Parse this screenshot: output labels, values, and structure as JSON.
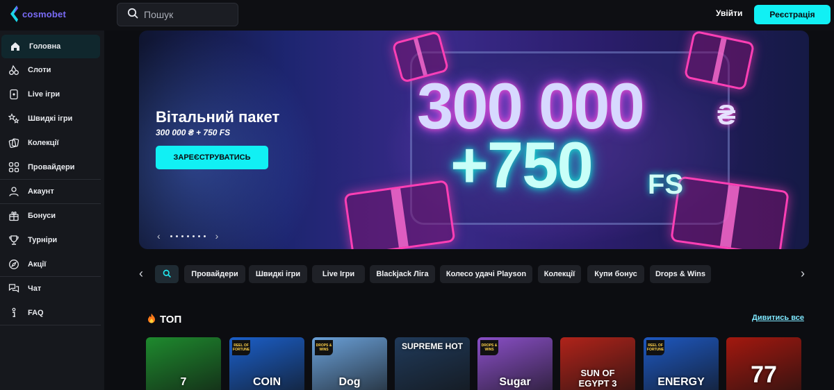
{
  "header": {
    "logo_text": "cosmobet",
    "search_placeholder": "Пошук",
    "login_label": "Увійти",
    "register_label": "Реєстрація"
  },
  "sidebar": {
    "items": [
      {
        "label": "Головна",
        "icon": "home-icon",
        "active": true
      },
      {
        "label": "Слоти",
        "icon": "cherries-icon"
      },
      {
        "label": "Live ігри",
        "icon": "cards-icon"
      },
      {
        "label": "Швидкі ігри",
        "icon": "stars-icon"
      },
      {
        "label": "Колекції",
        "icon": "collection-icon"
      },
      {
        "label": "Провайдери",
        "icon": "grid-icon"
      },
      {
        "label": "Акаунт",
        "icon": "user-icon"
      },
      {
        "label": "Бонуси",
        "icon": "gift-icon"
      },
      {
        "label": "Турніри",
        "icon": "trophy-icon"
      },
      {
        "label": "Акції",
        "icon": "compass-icon"
      },
      {
        "label": "Чат",
        "icon": "chat-icon"
      },
      {
        "label": "FAQ",
        "icon": "info-icon"
      }
    ]
  },
  "hero": {
    "title": "Вітальний пакет",
    "subtitle": "300 000 ₴ + 750 FS",
    "cta_label": "ЗАРЕЄСТРУВАТИСЬ",
    "banner_amount": "300 000",
    "banner_currency": "₴",
    "banner_spins": "+750",
    "banner_fs": "FS",
    "slide_count": 7
  },
  "chips": {
    "items": [
      "Провайдери",
      "Швидкі ігри",
      "Live Ігри",
      "Blackjack Ліга",
      "Колесо удачі Playson",
      "Колекції",
      "Купи бонус",
      "Drops & Wins"
    ]
  },
  "top_section": {
    "title": "ТОП",
    "see_all_label": "Дивитись все",
    "games": [
      {
        "label": "7",
        "bg": "#1e8a2e"
      },
      {
        "label": "COIN",
        "bg": "#1b5fc9",
        "badge": "REEL OF FORTUNE"
      },
      {
        "label": "Dog",
        "bg": "#6aa0d8",
        "badge": "DROPS & WINS"
      },
      {
        "label": "SUPREME HOT",
        "bg": "#203a5a"
      },
      {
        "label": "Sugar",
        "bg": "#8a4fc7",
        "badge": "DROPS & WINS"
      },
      {
        "label": "SUN OF EGYPT 3",
        "bg": "#b0231a"
      },
      {
        "label": "ENERGY",
        "bg": "#1e58c0",
        "badge": "REEL OF FORTUNE"
      },
      {
        "label": "77",
        "bg": "#a3180f"
      }
    ]
  },
  "colors": {
    "accent": "#11f0f4",
    "sidebar_bg": "#16181d",
    "active_bg": "#10272d"
  }
}
